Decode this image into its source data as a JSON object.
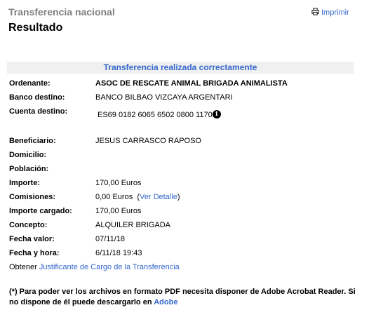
{
  "header": {
    "section_title": "Transferencia nacional",
    "page_title": "Resultado",
    "print_label": "Imprimir"
  },
  "banner": "Transferencia realizada correctamente",
  "details": {
    "ordenante_label": "Ordenante:",
    "ordenante_value": "ASOC DE RESCATE ANIMAL BRIGADA ANIMALISTA",
    "banco_label": "Banco destino:",
    "banco_value": "BANCO BILBAO VIZCAYA ARGENTARI",
    "cuenta_label": "Cuenta destino:",
    "cuenta_value": "ES69 0182 6065 6502 0800 1170",
    "info_glyph": "i",
    "beneficiario_label": "Beneficiario:",
    "beneficiario_value": "JESUS CARRASCO RAPOSO",
    "domicilio_label": "Domicilio:",
    "poblacion_label": "Población:",
    "importe_label": "Importe:",
    "importe_value": "170,00 Euros",
    "comisiones_label": "Comisiones:",
    "comisiones_value": "0,00 Euros",
    "comisiones_paren_open": "(",
    "comisiones_link": "Ver Detalle",
    "comisiones_paren_close": ")",
    "importe_cargado_label": "Importe cargado:",
    "importe_cargado_value": "170,00 Euros",
    "concepto_label": "Concepto:",
    "concepto_value": "ALQUILER BRIGADA",
    "fecha_valor_label": "Fecha valor:",
    "fecha_valor_value": "07/11/18",
    "fecha_hora_label": "Fecha y hora:",
    "fecha_hora_value": "6/11/18 19:43"
  },
  "obtener": {
    "prefix": "Obtener",
    "link": "Justificante de Cargo de la Transferencia"
  },
  "note": {
    "text": "(*) Para poder ver los archivos en formato PDF necesita disponer de Adobe Acrobat Reader. Si no dispone de él puede descargarlo en",
    "link": "Adobe"
  },
  "colors": {
    "accent": "#3366cc",
    "muted": "#808080",
    "banner_bg": "#f0f0f0"
  },
  "icons": {
    "print": "printer-icon",
    "info": "info-icon"
  }
}
